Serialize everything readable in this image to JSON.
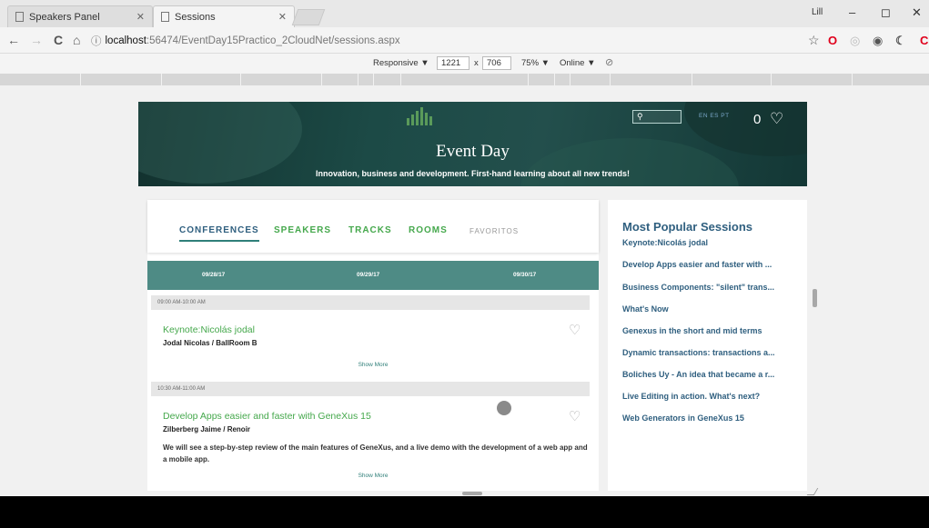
{
  "browser": {
    "tabs": [
      {
        "title": "Speakers Panel",
        "active": false
      },
      {
        "title": "Sessions",
        "active": true
      }
    ],
    "url_host": "localhost",
    "url_path": ":56474/EventDay15Practico_2CloudNet/sessions.aspx",
    "window_controls": {
      "minimize": "–",
      "restore": "◻",
      "close": "✕"
    },
    "nav": {
      "back": "←",
      "forward": "→",
      "reload": "C",
      "home": "⌂",
      "info": "ⓘ"
    },
    "toolbar_icons": {
      "star": "☆",
      "opera": "O"
    }
  },
  "devtools": {
    "device": "Responsive ▼",
    "width": "1221",
    "times": "x",
    "height": "706",
    "zoom": "75% ▼",
    "network": "Online ▼"
  },
  "page": {
    "title": "Event Day",
    "subtitle": "Innovation, business and development. First-hand learning about all new trends!",
    "languages": "EN ES PT",
    "favorites_count": "0",
    "tabs": [
      "CONFERENCES",
      "SPEAKERS",
      "TRACKS",
      "ROOMS",
      "FAVORITOS"
    ],
    "dates": [
      "09/28/17",
      "09/29/17",
      "09/30/17"
    ],
    "sessions": [
      {
        "time": "09:00 AM-10:00 AM",
        "title": "Keynote:Nicolás jodal",
        "meta": "Jodal Nicolas / BallRoom B",
        "description": "",
        "show_more": "Show More"
      },
      {
        "time": "10:30 AM-11:00 AM",
        "title": "Develop Apps easier and faster with GeneXus 15",
        "meta": "Zilberberg Jaime / Renoir",
        "description": "We will see a step-by-step review of the main features of GeneXus, and a live demo with the development of a web app and a mobile app.",
        "show_more": "Show More"
      }
    ],
    "popular": {
      "heading": "Most Popular Sessions",
      "items": [
        "Keynote:Nicolás jodal",
        "Develop Apps easier and faster with ...",
        "Business Components: \"silent\" trans...",
        "What's Now",
        "Genexus in the short and mid terms",
        "Dynamic transactions: transactions a...",
        "Boliches Uy - An idea that became a r...",
        "Live Editing in action. What's next?",
        "Web Generators in GeneXus 15"
      ]
    }
  },
  "colors": {
    "accent_green": "#45a84c",
    "accent_blue": "#2f5f7f",
    "date_bar": "#4e8b85",
    "hero_dark": "#12312e"
  }
}
